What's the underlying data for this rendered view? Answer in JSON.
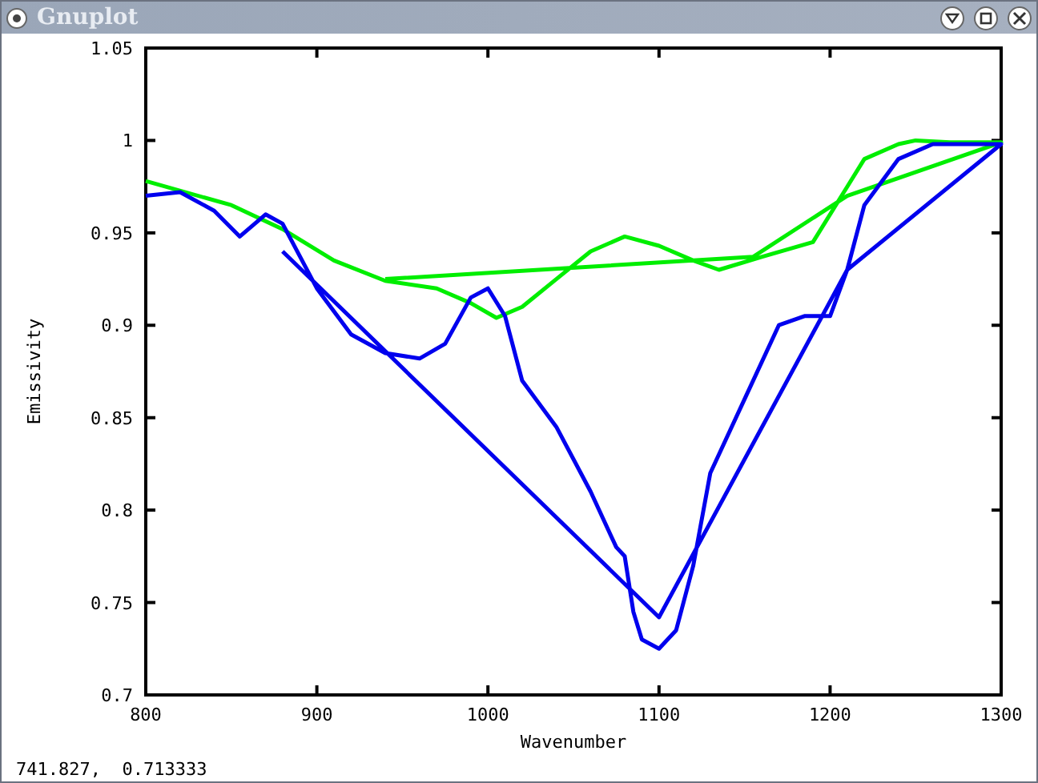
{
  "window": {
    "title": "Gnuplot"
  },
  "plot": {
    "chart_data": {
      "type": "line",
      "xlabel": "Wavenumber",
      "ylabel": "Emissivity",
      "xlim": [
        800,
        1300
      ],
      "ylim": [
        0.7,
        1.05
      ],
      "xticks": [
        {
          "value": 800,
          "label": "800"
        },
        {
          "value": 900,
          "label": "900"
        },
        {
          "value": 1000,
          "label": "1000"
        },
        {
          "value": 1100,
          "label": "1100"
        },
        {
          "value": 1200,
          "label": "1200"
        },
        {
          "value": 1300,
          "label": "1300"
        }
      ],
      "yticks": [
        {
          "value": 0.7,
          "label": "0.7"
        },
        {
          "value": 0.75,
          "label": "0.75"
        },
        {
          "value": 0.8,
          "label": "0.8"
        },
        {
          "value": 0.85,
          "label": "0.85"
        },
        {
          "value": 0.9,
          "label": "0.9"
        },
        {
          "value": 0.95,
          "label": "0.95"
        },
        {
          "value": 1,
          "label": "1"
        },
        {
          "value": 1.05,
          "label": "1.05"
        }
      ],
      "series": [
        {
          "color": "#00ee00",
          "x": [
            800,
            850,
            880,
            910,
            940,
            970,
            990,
            1005,
            1020,
            1040,
            1060,
            1080,
            1100,
            1120,
            1135,
            1160,
            1190,
            1210,
            1220,
            1240,
            1250,
            1270,
            1300,
            1210,
            1155,
            940
          ],
          "values": [
            0.978,
            0.965,
            0.952,
            0.935,
            0.924,
            0.92,
            0.912,
            0.904,
            0.91,
            0.925,
            0.94,
            0.948,
            0.943,
            0.935,
            0.93,
            0.937,
            0.945,
            0.975,
            0.99,
            0.998,
            1.0,
            0.999,
            0.999,
            0.97,
            0.937,
            0.925
          ]
        },
        {
          "color": "#0000ee",
          "x": [
            800,
            820,
            840,
            855,
            870,
            880,
            900,
            920,
            940,
            960,
            975,
            990,
            1000,
            1010,
            1020,
            1040,
            1060,
            1075,
            1080,
            1085,
            1090,
            1100,
            1110,
            1120,
            1130,
            1150,
            1170,
            1185,
            1200,
            1210,
            1220,
            1240,
            1260,
            1300,
            1210,
            1100,
            880
          ],
          "values": [
            0.97,
            0.972,
            0.962,
            0.948,
            0.96,
            0.955,
            0.92,
            0.895,
            0.885,
            0.882,
            0.89,
            0.915,
            0.92,
            0.905,
            0.87,
            0.845,
            0.81,
            0.78,
            0.775,
            0.745,
            0.73,
            0.725,
            0.735,
            0.77,
            0.82,
            0.86,
            0.9,
            0.905,
            0.905,
            0.93,
            0.965,
            0.99,
            0.998,
            0.998,
            0.93,
            0.742,
            0.94
          ]
        }
      ]
    }
  },
  "status_bar": {
    "text": "741.827,  0.713333"
  }
}
